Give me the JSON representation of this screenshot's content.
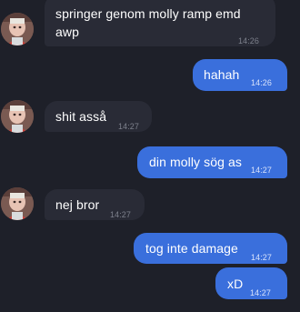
{
  "chat": {
    "messages": [
      {
        "direction": "incoming",
        "lines": [
          "springer genom molly ramp emd",
          "awp"
        ],
        "time": "14:26",
        "has_avatar": true
      },
      {
        "direction": "outgoing",
        "lines": [
          "hahah"
        ],
        "time": "14:26"
      },
      {
        "direction": "incoming",
        "lines": [
          "shit asså"
        ],
        "time": "14:27",
        "has_avatar": true
      },
      {
        "direction": "outgoing",
        "lines": [
          "din molly sög as"
        ],
        "time": "14:27"
      },
      {
        "direction": "incoming",
        "lines": [
          "nej bror"
        ],
        "time": "14:27",
        "has_avatar": true
      },
      {
        "direction": "outgoing",
        "lines": [
          "tog inte damage"
        ],
        "time": "14:27"
      },
      {
        "direction": "outgoing",
        "lines": [
          "xD"
        ],
        "time": "14:27"
      }
    ]
  },
  "theme": {
    "background": "#1e2029",
    "incoming_bubble": "#292b36",
    "outgoing_bubble": "#3a6fdc",
    "timestamp_incoming": "#7d808c",
    "timestamp_outgoing": "#d7e2fb"
  },
  "icons": {
    "avatar": "user-avatar-photo"
  }
}
